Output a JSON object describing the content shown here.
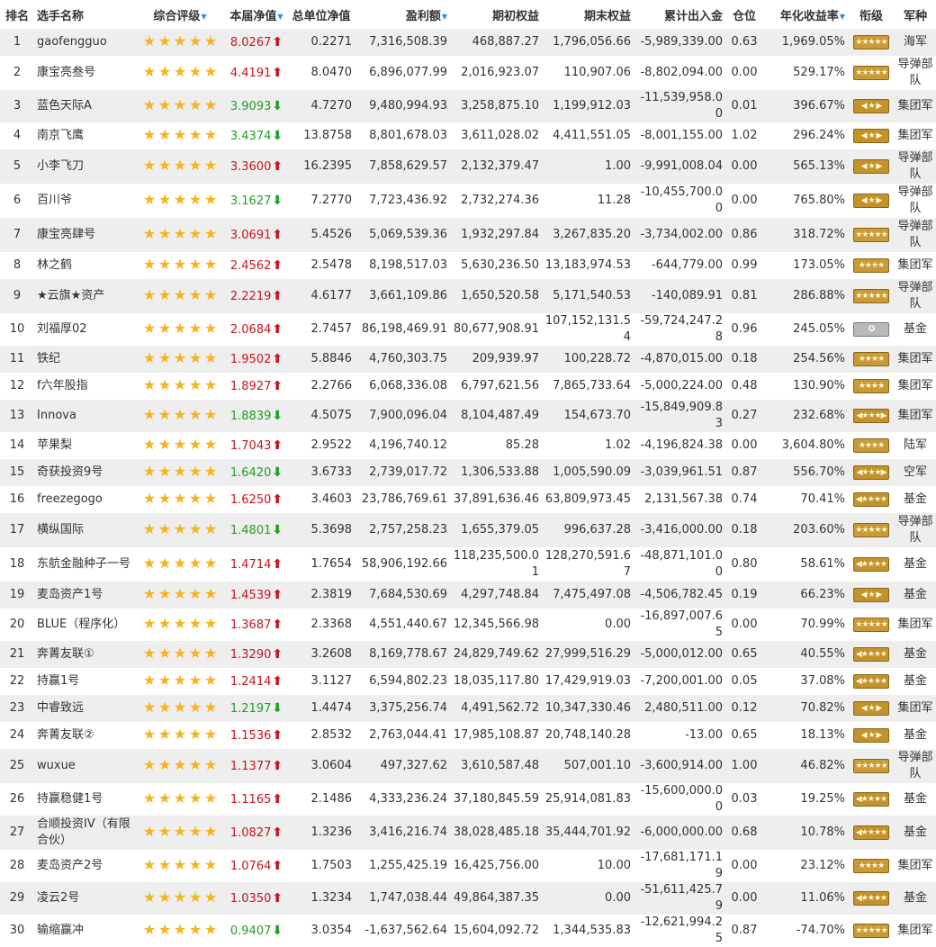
{
  "headers": {
    "rank": "排名",
    "name": "选手名称",
    "rating": "综合评级",
    "nav": "本届净值",
    "total_nav": "总单位净值",
    "profit": "盈利额",
    "start_equity": "期初权益",
    "end_equity": "期末权益",
    "cum_flow": "累计出入金",
    "position": "仓位",
    "annual": "年化收益率",
    "rank_title": "衔级",
    "army": "军种"
  },
  "sortable": [
    "rating",
    "nav",
    "profit",
    "annual"
  ],
  "colors": {
    "up": "#c8141c",
    "down": "#1fa01f",
    "star": "#f7b21c",
    "badge": "#c99a35",
    "sort": "#2a8fd8"
  },
  "rows": [
    {
      "rank": "1",
      "name": "gaofengguo",
      "stars": 5,
      "nav": "8.0267",
      "dir": "up",
      "total_nav": "0.2271",
      "profit": "7,316,508.39",
      "start": "468,887.27",
      "end": "1,796,056.66",
      "flow": "-5,989,339.00",
      "pos": "0.63",
      "annual": "1,969.05%",
      "badge": "★★★★★",
      "army": "海军"
    },
    {
      "rank": "2",
      "name": "康宝亮叁号",
      "stars": 5,
      "nav": "4.4191",
      "dir": "up",
      "total_nav": "8.0470",
      "profit": "6,896,077.99",
      "start": "2,016,923.07",
      "end": "110,907.06",
      "flow": "-8,802,094.00",
      "pos": "0.00",
      "annual": "529.17%",
      "badge": "★★★★★",
      "army": "导弹部队"
    },
    {
      "rank": "3",
      "name": "蓝色天际A",
      "stars": 5,
      "nav": "3.9093",
      "dir": "down",
      "total_nav": "4.7270",
      "profit": "9,480,994.93",
      "start": "3,258,875.10",
      "end": "1,199,912.03",
      "flow": "-11,539,958.00",
      "pos": "0.01",
      "annual": "396.67%",
      "badge": "◀ ★ ▶",
      "army": "集团军"
    },
    {
      "rank": "4",
      "name": "南京飞鹰",
      "stars": 5,
      "nav": "3.4374",
      "dir": "down",
      "total_nav": "13.8758",
      "profit": "8,801,678.03",
      "start": "3,611,028.02",
      "end": "4,411,551.05",
      "flow": "-8,001,155.00",
      "pos": "1.02",
      "annual": "296.24%",
      "badge": "◀ ★ ▶",
      "army": "集团军"
    },
    {
      "rank": "5",
      "name": "小李飞刀",
      "stars": 5,
      "nav": "3.3600",
      "dir": "up",
      "total_nav": "16.2395",
      "profit": "7,858,629.57",
      "start": "2,132,379.47",
      "end": "1.00",
      "flow": "-9,991,008.04",
      "pos": "0.00",
      "annual": "565.13%",
      "badge": "◀ ★ ▶",
      "army": "导弹部队"
    },
    {
      "rank": "6",
      "name": "百川爷",
      "stars": 5,
      "nav": "3.1627",
      "dir": "down",
      "total_nav": "7.2770",
      "profit": "7,723,436.92",
      "start": "2,732,274.36",
      "end": "11.28",
      "flow": "-10,455,700.00",
      "pos": "0.00",
      "annual": "765.80%",
      "badge": "◀ ★ ▶",
      "army": "导弹部队"
    },
    {
      "rank": "7",
      "name": "康宝亮肆号",
      "stars": 5,
      "nav": "3.0691",
      "dir": "up",
      "total_nav": "5.4526",
      "profit": "5,069,539.36",
      "start": "1,932,297.84",
      "end": "3,267,835.20",
      "flow": "-3,734,002.00",
      "pos": "0.86",
      "annual": "318.72%",
      "badge": "★★★★★",
      "army": "导弹部队"
    },
    {
      "rank": "8",
      "name": "林之鹤",
      "stars": 5,
      "nav": "2.4562",
      "dir": "up",
      "total_nav": "2.5478",
      "profit": "8,198,517.03",
      "start": "5,630,236.50",
      "end": "13,183,974.53",
      "flow": "-644,779.00",
      "pos": "0.99",
      "annual": "173.05%",
      "badge": "★★★★",
      "army": "集团军"
    },
    {
      "rank": "9",
      "name": "★云旗★资产",
      "stars": 5,
      "nav": "2.2219",
      "dir": "up",
      "total_nav": "4.6177",
      "profit": "3,661,109.86",
      "start": "1,650,520.58",
      "end": "5,171,540.53",
      "flow": "-140,089.91",
      "pos": "0.81",
      "annual": "286.88%",
      "badge": "★★★★★",
      "army": "导弹部队"
    },
    {
      "rank": "10",
      "name": "刘福厚02",
      "stars": 5,
      "nav": "2.0684",
      "dir": "up",
      "total_nav": "2.7457",
      "profit": "86,198,469.91",
      "start": "80,677,908.91",
      "end": "107,152,131.54",
      "flow": "-59,724,247.28",
      "pos": "0.96",
      "annual": "245.05%",
      "badge": "✪",
      "army": "基金"
    },
    {
      "rank": "11",
      "name": "铁纪",
      "stars": 5,
      "nav": "1.9502",
      "dir": "up",
      "total_nav": "5.8846",
      "profit": "4,760,303.75",
      "start": "209,939.97",
      "end": "100,228.72",
      "flow": "-4,870,015.00",
      "pos": "0.18",
      "annual": "254.56%",
      "badge": "★★★★",
      "army": "集团军"
    },
    {
      "rank": "12",
      "name": "f六年股指",
      "stars": 5,
      "nav": "1.8927",
      "dir": "up",
      "total_nav": "2.2766",
      "profit": "6,068,336.08",
      "start": "6,797,621.56",
      "end": "7,865,733.64",
      "flow": "-5,000,224.00",
      "pos": "0.48",
      "annual": "130.90%",
      "badge": "★★★★",
      "army": "集团军"
    },
    {
      "rank": "13",
      "name": "Innova",
      "stars": 5,
      "nav": "1.8839",
      "dir": "down",
      "total_nav": "4.5075",
      "profit": "7,900,096.04",
      "start": "8,104,487.49",
      "end": "154,673.70",
      "flow": "-15,849,909.83",
      "pos": "0.27",
      "annual": "232.68%",
      "badge": "◀★★★▶",
      "army": "集团军"
    },
    {
      "rank": "14",
      "name": "苹果梨",
      "stars": 5,
      "nav": "1.7043",
      "dir": "up",
      "total_nav": "2.9522",
      "profit": "4,196,740.12",
      "start": "85.28",
      "end": "1.02",
      "flow": "-4,196,824.38",
      "pos": "0.00",
      "annual": "3,604.80%",
      "badge": "★★★★",
      "army": "陆军"
    },
    {
      "rank": "15",
      "name": "奇获投资9号",
      "stars": 5,
      "nav": "1.6420",
      "dir": "down",
      "total_nav": "3.6733",
      "profit": "2,739,017.72",
      "start": "1,306,533.88",
      "end": "1,005,590.09",
      "flow": "-3,039,961.51",
      "pos": "0.87",
      "annual": "556.70%",
      "badge": "◀★★★▶",
      "army": "空军"
    },
    {
      "rank": "16",
      "name": "freezegogo",
      "stars": 5,
      "nav": "1.6250",
      "dir": "up",
      "total_nav": "3.4603",
      "profit": "23,786,769.61",
      "start": "37,891,636.46",
      "end": "63,809,973.45",
      "flow": "2,131,567.38",
      "pos": "0.74",
      "annual": "70.41%",
      "badge": "◀★★★★▶",
      "army": "基金"
    },
    {
      "rank": "17",
      "name": "横纵国际",
      "stars": 5,
      "nav": "1.4801",
      "dir": "down",
      "total_nav": "5.3698",
      "profit": "2,757,258.23",
      "start": "1,655,379.05",
      "end": "996,637.28",
      "flow": "-3,416,000.00",
      "pos": "0.18",
      "annual": "203.60%",
      "badge": "★★★★★",
      "army": "导弹部队"
    },
    {
      "rank": "18",
      "name": "东航金融种子一号",
      "stars": 5,
      "nav": "1.4714",
      "dir": "up",
      "total_nav": "1.7654",
      "profit": "58,906,192.66",
      "start": "118,235,500.01",
      "end": "128,270,591.67",
      "flow": "-48,871,101.00",
      "pos": "0.80",
      "annual": "58.61%",
      "badge": "◀★★★★▶",
      "army": "基金"
    },
    {
      "rank": "19",
      "name": "麦岛资产1号",
      "stars": 5,
      "nav": "1.4539",
      "dir": "up",
      "total_nav": "2.3819",
      "profit": "7,684,530.69",
      "start": "4,297,748.84",
      "end": "7,475,497.08",
      "flow": "-4,506,782.45",
      "pos": "0.19",
      "annual": "66.23%",
      "badge": "◀ ★ ▶",
      "army": "基金"
    },
    {
      "rank": "20",
      "name": "BLUE（程序化）",
      "stars": 5,
      "nav": "1.3687",
      "dir": "up",
      "total_nav": "2.3368",
      "profit": "4,551,440.67",
      "start": "12,345,566.98",
      "end": "0.00",
      "flow": "-16,897,007.65",
      "pos": "0.00",
      "annual": "70.99%",
      "badge": "★★★★★",
      "army": "集团军"
    },
    {
      "rank": "21",
      "name": "奔菁友联①",
      "stars": 5,
      "nav": "1.3290",
      "dir": "up",
      "total_nav": "3.2608",
      "profit": "8,169,778.67",
      "start": "24,829,749.62",
      "end": "27,999,516.29",
      "flow": "-5,000,012.00",
      "pos": "0.65",
      "annual": "40.55%",
      "badge": "◀★★★★▶",
      "army": "基金"
    },
    {
      "rank": "22",
      "name": "持赢1号",
      "stars": 5,
      "nav": "1.2414",
      "dir": "up",
      "total_nav": "3.1127",
      "profit": "6,594,802.23",
      "start": "18,035,117.80",
      "end": "17,429,919.03",
      "flow": "-7,200,001.00",
      "pos": "0.05",
      "annual": "37.08%",
      "badge": "◀★★★★▶",
      "army": "基金"
    },
    {
      "rank": "23",
      "name": "中睿致远",
      "stars": 5,
      "nav": "1.2197",
      "dir": "down",
      "total_nav": "1.4474",
      "profit": "3,375,256.74",
      "start": "4,491,562.72",
      "end": "10,347,330.46",
      "flow": "2,480,511.00",
      "pos": "0.12",
      "annual": "70.82%",
      "badge": "◀ ★ ▶",
      "army": "集团军"
    },
    {
      "rank": "24",
      "name": "奔菁友联②",
      "stars": 5,
      "nav": "1.1536",
      "dir": "up",
      "total_nav": "2.8532",
      "profit": "2,763,044.41",
      "start": "17,985,108.87",
      "end": "20,748,140.28",
      "flow": "-13.00",
      "pos": "0.65",
      "annual": "18.13%",
      "badge": "◀ ★ ▶",
      "army": "基金"
    },
    {
      "rank": "25",
      "name": "wuxue",
      "stars": 5,
      "nav": "1.1377",
      "dir": "up",
      "total_nav": "3.0604",
      "profit": "497,327.62",
      "start": "3,610,587.48",
      "end": "507,001.10",
      "flow": "-3,600,914.00",
      "pos": "1.00",
      "annual": "46.82%",
      "badge": "★★★★★",
      "army": "导弹部队"
    },
    {
      "rank": "26",
      "name": "持赢稳健1号",
      "stars": 5,
      "nav": "1.1165",
      "dir": "up",
      "total_nav": "2.1486",
      "profit": "4,333,236.24",
      "start": "37,180,845.59",
      "end": "25,914,081.83",
      "flow": "-15,600,000.00",
      "pos": "0.03",
      "annual": "19.25%",
      "badge": "◀★★★★▶",
      "army": "基金"
    },
    {
      "rank": "27",
      "name": "合顺投资IV（有限合伙）",
      "stars": 5,
      "nav": "1.0827",
      "dir": "up",
      "total_nav": "1.3236",
      "profit": "3,416,216.74",
      "start": "38,028,485.18",
      "end": "35,444,701.92",
      "flow": "-6,000,000.00",
      "pos": "0.68",
      "annual": "10.78%",
      "badge": "◀★★★★▶",
      "army": "基金"
    },
    {
      "rank": "28",
      "name": "麦岛资产2号",
      "stars": 5,
      "nav": "1.0764",
      "dir": "up",
      "total_nav": "1.7503",
      "profit": "1,255,425.19",
      "start": "16,425,756.00",
      "end": "10.00",
      "flow": "-17,681,171.19",
      "pos": "0.00",
      "annual": "23.12%",
      "badge": "★★★★",
      "army": "集团军"
    },
    {
      "rank": "29",
      "name": "凌云2号",
      "stars": 5,
      "nav": "1.0350",
      "dir": "up",
      "total_nav": "1.3234",
      "profit": "1,747,038.44",
      "start": "49,864,387.35",
      "end": "0.00",
      "flow": "-51,611,425.79",
      "pos": "0.00",
      "annual": "11.06%",
      "badge": "◀★★★★▶",
      "army": "基金"
    },
    {
      "rank": "30",
      "name": "输缩赢冲",
      "stars": 5,
      "nav": "0.9407",
      "dir": "down",
      "total_nav": "3.0354",
      "profit": "-1,637,562.64",
      "start": "15,604,092.72",
      "end": "1,344,535.83",
      "flow": "-12,621,994.25",
      "pos": "0.87",
      "annual": "-74.70%",
      "badge": "★★★★★",
      "army": "集团军"
    }
  ]
}
